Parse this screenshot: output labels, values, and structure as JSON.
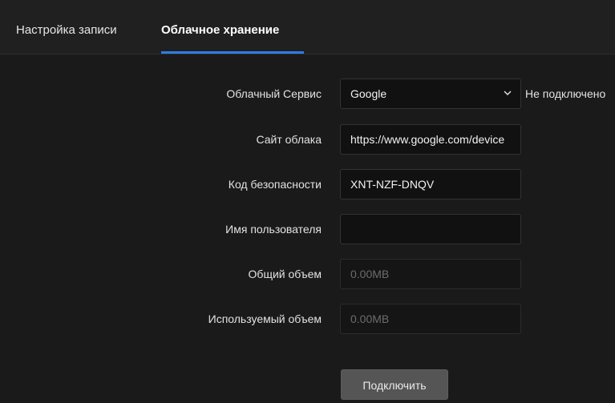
{
  "tabs": {
    "record_settings": "Настройка записи",
    "cloud_storage": "Облачное хранение"
  },
  "form": {
    "cloud_service": {
      "label": "Облачный Сервис",
      "value": "Google",
      "status": "Не подключено"
    },
    "cloud_site": {
      "label": "Сайт облака",
      "value": "https://www.google.com/device"
    },
    "security_code": {
      "label": "Код безопасности",
      "value": "XNT-NZF-DNQV"
    },
    "username": {
      "label": "Имя пользователя",
      "value": ""
    },
    "total_capacity": {
      "label": "Общий объем",
      "value": "0.00MB"
    },
    "used_capacity": {
      "label": "Используемый объем",
      "value": "0.00MB"
    }
  },
  "actions": {
    "connect_label": "Подключить"
  },
  "icons": {
    "select_arrow": "chevron-down-icon"
  },
  "colors": {
    "accent": "#2f7be6",
    "background": "#1a1a1a",
    "field_background": "#111111",
    "button_background": "#555555"
  }
}
